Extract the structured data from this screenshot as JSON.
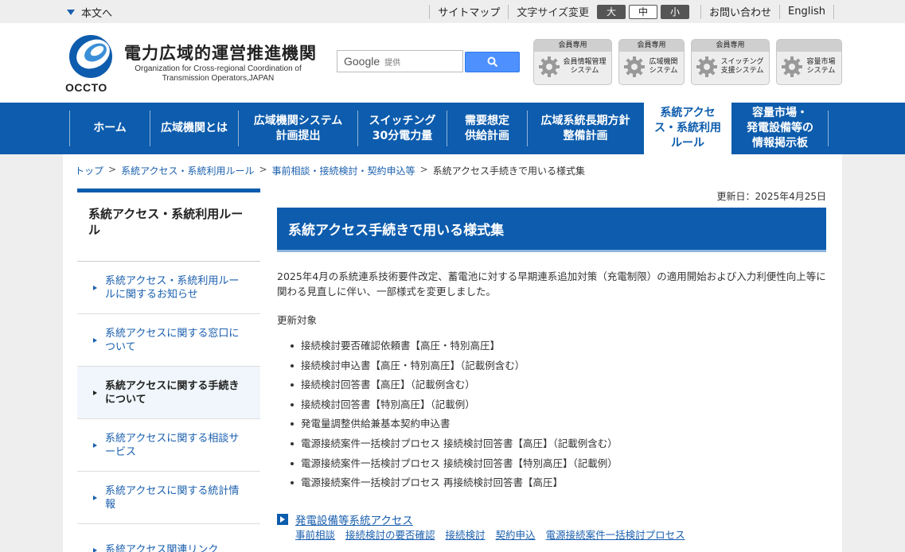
{
  "topbar": {
    "skip_label": "本文へ",
    "sitemap": "サイトマップ",
    "font_size_label": "文字サイズ変更",
    "font_large": "大",
    "font_medium": "中",
    "font_small": "小",
    "contact": "お問い合わせ",
    "english": "English"
  },
  "header": {
    "logo_text": "OCCTO",
    "org_name_jp": "電力広域的運営推進機関",
    "org_name_en_1": "Organization for Cross-regional Coordination of",
    "org_name_en_2": "Transmission Operators,JAPAN",
    "search_brand": "Google",
    "search_placeholder": "提供",
    "member_buttons": [
      {
        "header": "会員専用",
        "line1": "会員情報管理",
        "line2": "システム"
      },
      {
        "header": "会員専用",
        "line1": "広域機関",
        "line2": "システム"
      },
      {
        "header": "会員専用",
        "line1": "スイッチング",
        "line2": "支援システム"
      },
      {
        "header": "",
        "line1": "容量市場",
        "line2": "システム"
      }
    ]
  },
  "gnav": {
    "items": [
      {
        "line1": "ホーム",
        "line2": ""
      },
      {
        "line1": "広域機関とは",
        "line2": ""
      },
      {
        "line1": "広域機関システム",
        "line2": "計画提出"
      },
      {
        "line1": "スイッチング",
        "line2": "30分電力量"
      },
      {
        "line1": "需要想定",
        "line2": "供給計画"
      },
      {
        "line1": "広域系統長期方針",
        "line2": "整備計画"
      },
      {
        "line1": "系統アクセ",
        "line2": "ス・系統利用",
        "line3": "ルール"
      },
      {
        "line1": "容量市場・",
        "line2": "発電設備等の",
        "line3": "情報掲示板"
      }
    ]
  },
  "breadcrumb": [
    "トップ",
    "系統アクセス・系統利用ルール",
    "事前相談・接続検討・契約申込等",
    "系統アクセス手続きで用いる様式集"
  ],
  "sidebar": {
    "title": "系統アクセス・系統利用ルール",
    "items": [
      "系統アクセス・系統利用ルールに関するお知らせ",
      "系統アクセスに関する窓口について",
      "系統アクセスに関する手続きについて",
      "系統アクセスに関する相談サービス",
      "系統アクセスに関する統計情報",
      "系統アクセス関連リンク"
    ]
  },
  "main": {
    "updated": "更新日：2025年4月25日",
    "title": "系統アクセス手続きで用いる様式集",
    "intro": "2025年4月の系統連系技術要件改定、蓄電池に対する早期連系追加対策（充電制限）の適用開始および入力利便性向上等に関わる見直しに伴い、一部様式を変更しました。",
    "target_label": "更新対象",
    "items": [
      "接続検討要否確認依頼書【高圧・特別高圧】",
      "接続検討申込書【高圧・特別高圧】（記載例含む）",
      "接続検討回答書【高圧】（記載例含む）",
      "接続検討回答書【特別高圧】（記載例）",
      "発電量調整供給兼基本契約申込書",
      "電源接続案件一括検討プロセス 接続検討回答書【高圧】（記載例含む）",
      "電源接続案件一括検討プロセス 接続検討回答書【特別高圧】（記載例）",
      "電源接続案件一括検討プロセス 再接続検討回答書【高圧】"
    ],
    "related_heading": "発電設備等系統アクセス",
    "related_links": [
      "事前相談",
      "接続検討の要否確認",
      "接続検討",
      "契約申込",
      "電源接続案件一括検討プロセス"
    ]
  },
  "colors": {
    "brand_blue": "#0d5cad",
    "link_blue": "#1a5fae",
    "search_blue": "#4d90fe"
  }
}
